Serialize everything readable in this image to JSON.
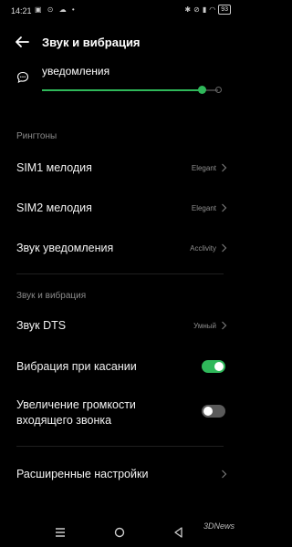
{
  "status": {
    "time": "14:21",
    "battery": "93"
  },
  "header": {
    "title": "Звук и вибрация"
  },
  "notifications_volume": {
    "label": "уведомления",
    "level_percent": 91
  },
  "sections": {
    "ringtones_header": "Рингтоны",
    "sound_vibration_header": "Звук и вибрация"
  },
  "ringtones": [
    {
      "label": "SIM1 мелодия",
      "value": "Elegant"
    },
    {
      "label": "SIM2 мелодия",
      "value": "Elegant"
    },
    {
      "label": "Звук уведомления",
      "value": "Acclivity"
    }
  ],
  "dts": {
    "label": "Звук DTS",
    "value": "Умный"
  },
  "touch_vibration": {
    "label": "Вибрация при касании",
    "state": "on"
  },
  "increasing_volume": {
    "label": "Увеличение громкости входящего звонка",
    "state": "off"
  },
  "advanced": {
    "label": "Расширенные настройки"
  },
  "colors": {
    "accent": "#2fb85a",
    "background": "#000000"
  },
  "watermark": "3DNews"
}
